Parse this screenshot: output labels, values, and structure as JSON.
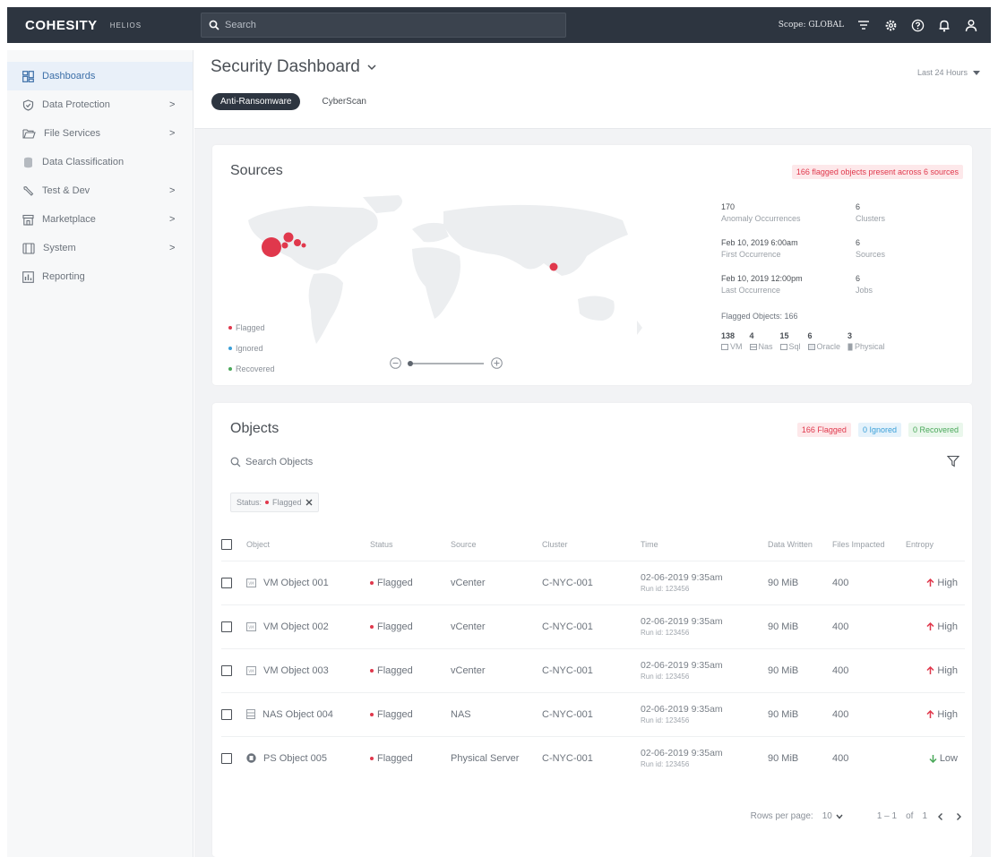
{
  "topbar": {
    "brand": "COHESITY",
    "brand_sub": "HELIOS",
    "search_placeholder": "Search",
    "scope": "Scope: GLOBAL"
  },
  "sidebar": {
    "items": [
      {
        "label": "Dashboards",
        "icon": "dashboard-icon",
        "chevron": false,
        "active": true
      },
      {
        "label": "Data Protection",
        "icon": "shield-icon",
        "chevron": true
      },
      {
        "label": "File Services",
        "icon": "folder-icon",
        "chevron": true
      },
      {
        "label": "Data Classification",
        "icon": "database-icon",
        "chevron": false
      },
      {
        "label": "Test & Dev",
        "icon": "wrench-icon",
        "chevron": true
      },
      {
        "label": "Marketplace",
        "icon": "store-icon",
        "chevron": true
      },
      {
        "label": "System",
        "icon": "server-icon",
        "chevron": true
      },
      {
        "label": "Reporting",
        "icon": "report-icon",
        "chevron": false
      }
    ]
  },
  "page": {
    "title": "Security Dashboard",
    "time_range": "Last 24 Hours",
    "tabs": [
      "Anti-Ransomware",
      "CyberScan"
    ]
  },
  "sources": {
    "title": "Sources",
    "flag_summary": "166 flagged objects present across 6 sources",
    "legend": [
      "Flagged",
      "Ignored",
      "Recovered"
    ],
    "stats": [
      {
        "value": "170",
        "label": "Anomaly Occurrences"
      },
      {
        "value": "6",
        "label": "Clusters"
      },
      {
        "value": "Feb 10, 2019 6:00am",
        "label": "First Occurrence"
      },
      {
        "value": "6",
        "label": "Sources"
      },
      {
        "value": "Feb 10, 2019 12:00pm",
        "label": "Last Occurrence"
      },
      {
        "value": "6",
        "label": "Jobs"
      }
    ],
    "flagged_objects": "Flagged Objects: 166",
    "types": [
      {
        "count": "138",
        "label": "VM"
      },
      {
        "count": "4",
        "label": "Nas"
      },
      {
        "count": "15",
        "label": "Sql"
      },
      {
        "count": "6",
        "label": "Oracle"
      },
      {
        "count": "3",
        "label": "Physical"
      }
    ]
  },
  "objects": {
    "title": "Objects",
    "pills": [
      "166 Flagged",
      "0 Ignored",
      "0 Recovered"
    ],
    "search_placeholder": "Search Objects",
    "filter_chip_prefix": "Status:",
    "filter_chip_value": "Flagged",
    "columns": [
      "Object",
      "Status",
      "Source",
      "Cluster",
      "Time",
      "Data Written",
      "Files Impacted",
      "Entropy"
    ],
    "rows": [
      {
        "name": "VM Object 001",
        "type": "vm",
        "status": "Flagged",
        "source": "vCenter",
        "cluster": "C-NYC-001",
        "time": "02-06-2019 9:35am",
        "run": "Run id: 123456",
        "data": "90 MiB",
        "files": "400",
        "entropy": "High"
      },
      {
        "name": "VM Object 002",
        "type": "vm",
        "status": "Flagged",
        "source": "vCenter",
        "cluster": "C-NYC-001",
        "time": "02-06-2019 9:35am",
        "run": "Run id: 123456",
        "data": "90 MiB",
        "files": "400",
        "entropy": "High"
      },
      {
        "name": "VM Object 003",
        "type": "vm",
        "status": "Flagged",
        "source": "vCenter",
        "cluster": "C-NYC-001",
        "time": "02-06-2019 9:35am",
        "run": "Run id: 123456",
        "data": "90 MiB",
        "files": "400",
        "entropy": "High"
      },
      {
        "name": "NAS Object 004",
        "type": "nas",
        "status": "Flagged",
        "source": "NAS",
        "cluster": "C-NYC-001",
        "time": "02-06-2019 9:35am",
        "run": "Run id: 123456",
        "data": "90 MiB",
        "files": "400",
        "entropy": "High"
      },
      {
        "name": "PS Object 005",
        "type": "ps",
        "status": "Flagged",
        "source": "Physical Server",
        "cluster": "C-NYC-001",
        "time": "02-06-2019 9:35am",
        "run": "Run id: 123456",
        "data": "90 MiB",
        "files": "400",
        "entropy": "Low"
      }
    ],
    "pager": {
      "rows_label": "Rows per page:",
      "rows_value": "10",
      "range": "1 – 1",
      "of": "of",
      "total": "1"
    }
  },
  "colors": {
    "flagged": "#e0384c",
    "ignored": "#3a9fd8",
    "recovered": "#4aa85a",
    "topbar": "#2d3540"
  }
}
